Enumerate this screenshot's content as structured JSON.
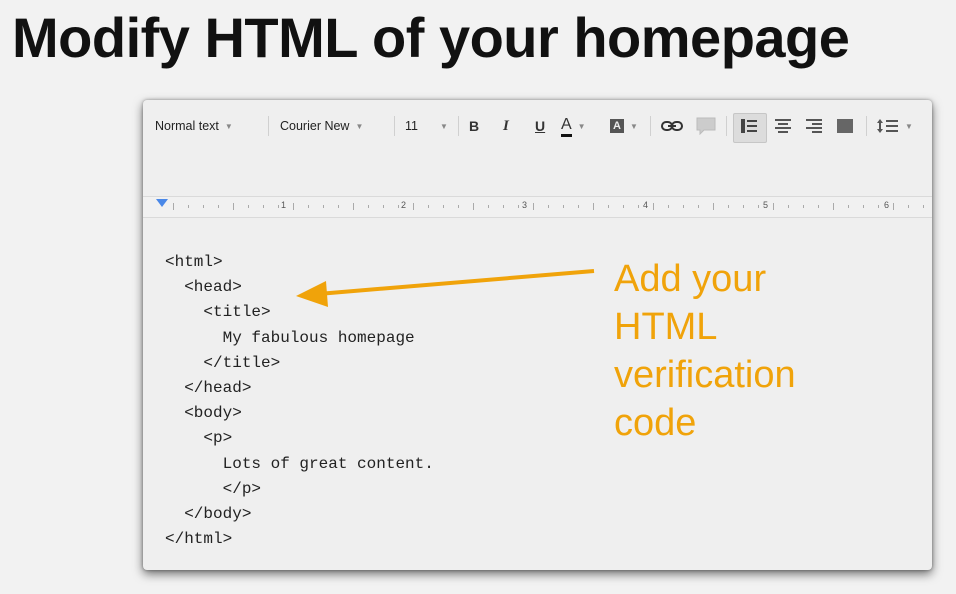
{
  "slide": {
    "title": "Modify HTML of your homepage"
  },
  "toolbar": {
    "style_select": "Normal text",
    "font_select": "Courier New",
    "size_select": "11",
    "bold_label": "B",
    "italic_label": "I",
    "underline_label": "U",
    "text_color_label": "A",
    "highlight_label": "A",
    "icons": [
      "link-icon",
      "comment-icon",
      "align-left-icon",
      "align-center-icon",
      "align-right-icon",
      "align-justify-icon",
      "line-spacing-icon"
    ]
  },
  "ruler": {
    "numbers": [
      "1",
      "2",
      "3",
      "4",
      "5",
      "6"
    ]
  },
  "code_lines": [
    "<html>",
    "  <head>",
    "    <title>",
    "      My fabulous homepage",
    "    </title>",
    "  </head>",
    "  <body>",
    "    <p>",
    "      Lots of great content.",
    "      </p>",
    "  </body>",
    "</html>"
  ],
  "annotation": {
    "lines": [
      "Add your",
      "HTML",
      "verification",
      "code"
    ]
  },
  "colors": {
    "annotation": "#f0a30a",
    "ruler_marker": "#4a88e8"
  }
}
